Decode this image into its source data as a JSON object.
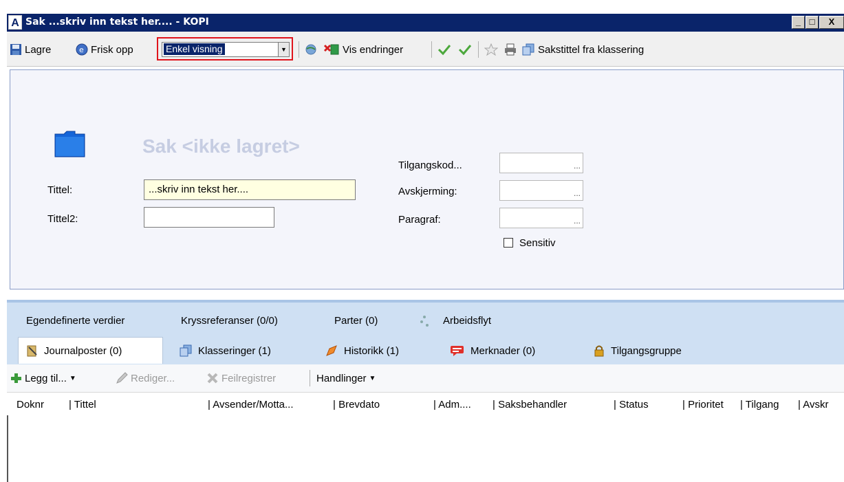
{
  "window": {
    "title": "Sak  ...skriv inn tekst her.... -  KOPI",
    "app_icon_letter": "A",
    "minimize": "_",
    "maximize": "□",
    "close": "X"
  },
  "toolbar": {
    "save_label": "Lagre",
    "refresh_label": "Frisk opp",
    "view_select_value": "Enkel visning",
    "show_changes_label": "Vis endringer",
    "case_title_from_classification_label": "Sakstittel fra klassering"
  },
  "form": {
    "case_title": "Sak <ikke lagret>",
    "tittel_label": "Tittel:",
    "tittel_value": "...skriv inn tekst her....",
    "tittel2_label": "Tittel2:",
    "tittel2_value": "",
    "tilgangskode_label": "Tilgangskod...",
    "avskjerming_label": "Avskjerming:",
    "paragraf_label": "Paragraf:",
    "lookup_button": "...",
    "sensitiv_label": "Sensitiv"
  },
  "tabs": {
    "row1": [
      {
        "label": "Egendefinerte verdier"
      },
      {
        "label": "Kryssreferanser (0/0)"
      },
      {
        "label": "Parter (0)"
      },
      {
        "label": "Arbeidsflyt"
      }
    ],
    "row2": [
      {
        "label": "Journalposter (0)"
      },
      {
        "label": "Klasseringer (1)"
      },
      {
        "label": "Historikk (1)"
      },
      {
        "label": "Merknader (0)"
      },
      {
        "label": "Tilgangsgruppe"
      }
    ]
  },
  "list_toolbar": {
    "add_label": "Legg til...",
    "edit_label": "Rediger...",
    "error_register_label": "Feilregistrer",
    "actions_label": "Handlinger"
  },
  "columns": [
    "Doknr",
    "| Tittel",
    "| Avsender/Motta...",
    "| Brevdato",
    "| Adm....",
    "| Saksbehandler",
    "| Status",
    "| Prioritet",
    "| Tilgang",
    "| Avskr"
  ],
  "colors": {
    "titlebar": "#0a246a",
    "highlight_border": "#e0141c",
    "tabs_bg": "#cfe0f3",
    "faded_title": "#c6cde2"
  }
}
